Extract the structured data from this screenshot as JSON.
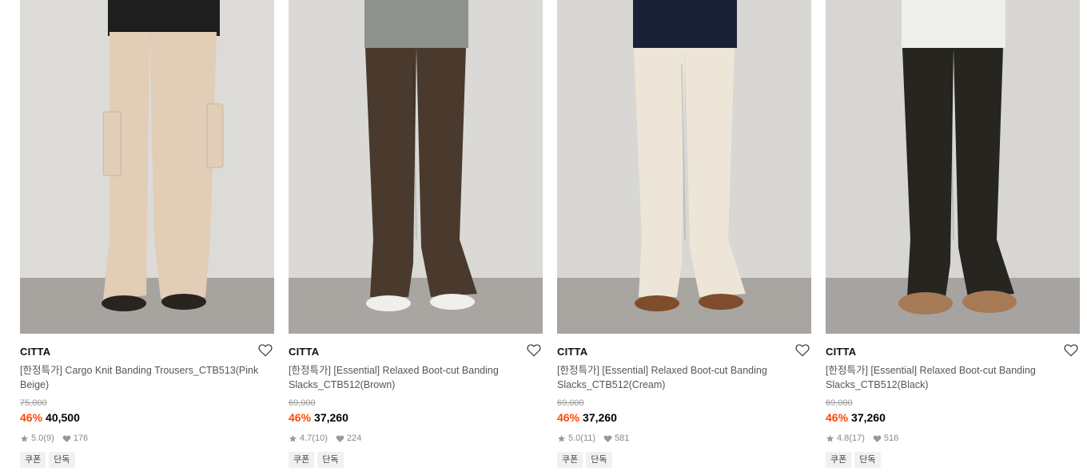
{
  "products": [
    {
      "brand": "CITTA",
      "title": "[한정특가] Cargo Knit Banding Trousers_CTB513(Pink Beige)",
      "original_price": "75,000",
      "discount": "46%",
      "price": "40,500",
      "rating": "5.0",
      "reviews": "(9)",
      "likes": "176",
      "tags": [
        "쿠폰",
        "단독"
      ],
      "colors": {
        "pants": "#e2cdb6",
        "top": "#1e1e1e",
        "shoes": "#2a2420",
        "bg": "#dcdbd8",
        "floor": "#a7a4a0"
      }
    },
    {
      "brand": "CITTA",
      "title": "[한정특가] [Essential] Relaxed Boot-cut Banding Slacks_CTB512(Brown)",
      "original_price": "69,000",
      "discount": "46%",
      "price": "37,260",
      "rating": "4.7",
      "reviews": "(10)",
      "likes": "224",
      "tags": [
        "쿠폰",
        "단독"
      ],
      "colors": {
        "pants": "#4a3a2e",
        "top": "#8f918e",
        "shoes": "#efefec",
        "bg": "#dad9d6",
        "floor": "#a9a6a2"
      }
    },
    {
      "brand": "CITTA",
      "title": "[한정특가] [Essential] Relaxed Boot-cut Banding Slacks_CTB512(Cream)",
      "original_price": "69,000",
      "discount": "46%",
      "price": "37,260",
      "rating": "5.0",
      "reviews": "(11)",
      "likes": "581",
      "tags": [
        "쿠폰",
        "단독"
      ],
      "colors": {
        "pants": "#ede6d8",
        "top": "#1b2134",
        "shoes": "#7e4d2c",
        "bg": "#d8d7d4",
        "floor": "#a8a5a1"
      }
    },
    {
      "brand": "CITTA",
      "title": "[한정특가] [Essential] Relaxed Boot-cut Banding Slacks_CTB512(Black)",
      "original_price": "69,000",
      "discount": "46%",
      "price": "37,260",
      "rating": "4.8",
      "reviews": "(17)",
      "likes": "516",
      "tags": [
        "쿠폰",
        "단독"
      ],
      "colors": {
        "pants": "#26251f",
        "top": "#eeeeea",
        "shoes": "#a57a55",
        "bg": "#d7d6d3",
        "floor": "#a6a3a0"
      }
    }
  ],
  "icons": {
    "wishlist": "heart-outline-icon",
    "rating": "star-icon",
    "likes": "heart-filled-icon"
  },
  "accent_color": "#ff4800"
}
